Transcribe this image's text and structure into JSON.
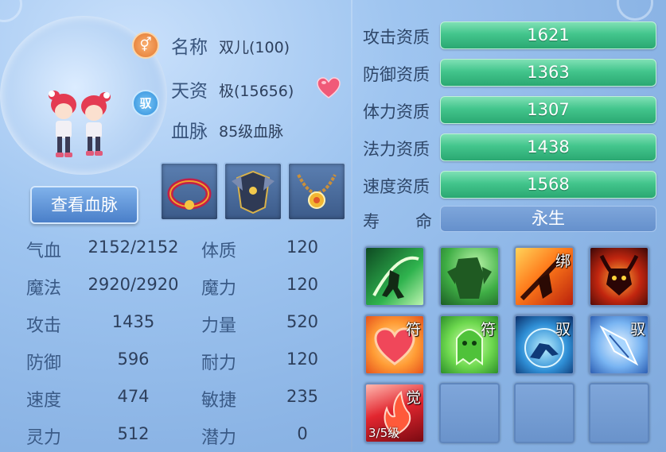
{
  "pet": {
    "name_label": "名称",
    "name_value": "双儿(100)",
    "talent_label": "天资",
    "talent_value": "极(15656)",
    "bloodline_label": "血脉",
    "bloodline_value": "85级血脉",
    "tame_badge": "驭",
    "view_bloodline_button": "查看血脉"
  },
  "stats": [
    {
      "label": "气血",
      "value": "2152/2152",
      "label2": "体质",
      "value2": "120"
    },
    {
      "label": "魔法",
      "value": "2920/2920",
      "label2": "魔力",
      "value2": "120"
    },
    {
      "label": "攻击",
      "value": "1435",
      "label2": "力量",
      "value2": "520"
    },
    {
      "label": "防御",
      "value": "596",
      "label2": "耐力",
      "value2": "120"
    },
    {
      "label": "速度",
      "value": "474",
      "label2": "敏捷",
      "value2": "235"
    },
    {
      "label": "灵力",
      "value": "512",
      "label2": "潜力",
      "value2": "0"
    }
  ],
  "qualities": [
    {
      "label": "攻击资质",
      "value": "1621"
    },
    {
      "label": "防御资质",
      "value": "1363"
    },
    {
      "label": "体力资质",
      "value": "1307"
    },
    {
      "label": "法力资质",
      "value": "1438"
    },
    {
      "label": "速度资质",
      "value": "1568"
    }
  ],
  "lifespan": {
    "label_a": "寿",
    "label_b": "命",
    "value": "永生"
  },
  "skills": [
    {
      "tag": "",
      "icon": "warrior-slash-icon"
    },
    {
      "tag": "",
      "icon": "green-ogre-icon"
    },
    {
      "tag": "绑",
      "icon": "fire-strike-icon"
    },
    {
      "tag": "",
      "icon": "demon-horned-icon"
    },
    {
      "tag": "符",
      "icon": "heart-shield-icon"
    },
    {
      "tag": "符",
      "icon": "green-ghost-icon"
    },
    {
      "tag": "驭",
      "icon": "water-beast-icon"
    },
    {
      "tag": "驭",
      "icon": "ice-crystal-icon"
    },
    {
      "tag": "觉",
      "icon": "flame-awaken-icon",
      "level": "3/5级"
    }
  ],
  "colors": {
    "accent_green": "#43c58c",
    "panel_blue": "#8db6e6",
    "label_blue": "#3a5a86"
  }
}
